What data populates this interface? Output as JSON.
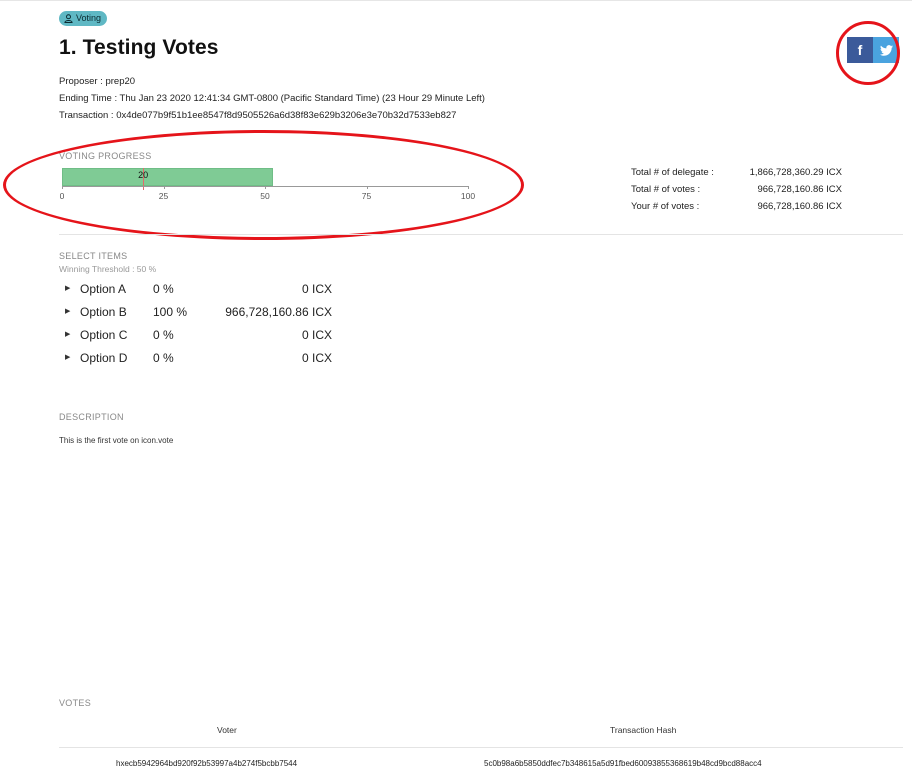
{
  "badge": {
    "label": "Voting",
    "icon": "person-icon"
  },
  "page": {
    "title": "1. Testing Votes"
  },
  "social": {
    "facebook_glyph": "f",
    "twitter_glyph": "✓"
  },
  "meta": {
    "proposer": "Proposer : prep20",
    "ending_time": "Ending Time : Thu Jan 23 2020 12:41:34 GMT-0800 (Pacific Standard Time) (23 Hour 29 Minute Left)",
    "transaction": "Transaction : 0x4de077b9f51b1ee8547f8d9505526a6d38f83e629b3206e3e70b32d7533eb827"
  },
  "progress": {
    "label": "VOTING PROGRESS",
    "value_percent": 52,
    "value_label": "20",
    "threshold_percent": 20,
    "ticks": [
      "0",
      "25",
      "50",
      "75",
      "100"
    ]
  },
  "totals": [
    {
      "label": "Total # of delegate :",
      "value": "1,866,728,360.29 ICX"
    },
    {
      "label": "Total # of votes :",
      "value": "966,728,160.86 ICX"
    },
    {
      "label": "Your # of votes :",
      "value": "966,728,160.86 ICX"
    }
  ],
  "select": {
    "label": "SELECT ITEMS",
    "threshold": "Winning Threshold : 50 %",
    "options": [
      {
        "name": "Option A",
        "pct": "0 %",
        "icx": "0 ICX"
      },
      {
        "name": "Option B",
        "pct": "100 %",
        "icx": "966,728,160.86 ICX"
      },
      {
        "name": "Option C",
        "pct": "0 %",
        "icx": "0 ICX"
      },
      {
        "name": "Option D",
        "pct": "0 %",
        "icx": "0 ICX"
      }
    ]
  },
  "description": {
    "label": "DESCRIPTION",
    "text": "This is the first vote on icon.vote"
  },
  "votes": {
    "label": "VOTES",
    "columns": [
      "Voter",
      "Transaction Hash"
    ],
    "rows": [
      {
        "voter": "hxecb5942964bd920f92b53997a4b274f5bcbb7544",
        "hash": "5c0b98a6b5850ddfec7b348615a5d91fbed60093855368619b48cd9bcd88acc4"
      }
    ]
  },
  "colors": {
    "accent": "#5fb8c4",
    "progress": "#7fcb95",
    "annotation": "#e5141a"
  }
}
